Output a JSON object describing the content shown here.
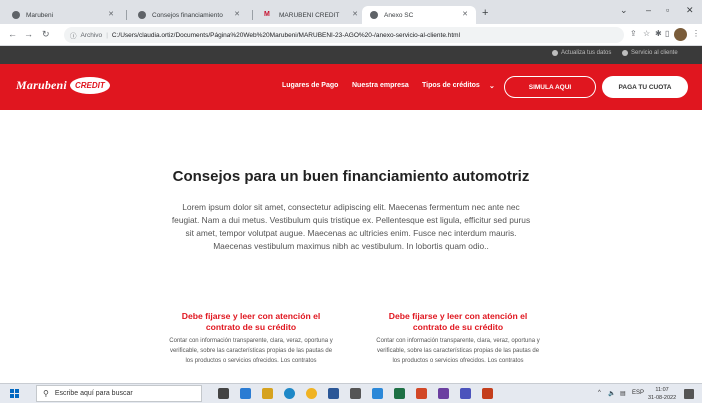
{
  "browser": {
    "tabs": [
      {
        "title": "Marubeni",
        "favicon": "globe-icon"
      },
      {
        "title": "Consejos financiamiento",
        "favicon": "globe-icon"
      },
      {
        "title": "MARUBENI CREDIT",
        "favicon": "m-logo-icon"
      },
      {
        "title": "Anexo SC",
        "favicon": "globe-icon",
        "active": true
      }
    ],
    "address": {
      "scheme_label": "Archivo",
      "url": "C:/Users/claudia.ortiz/Documents/Página%20Web%20Marubeni/MARUBENI-23-AGO%20-/anexo-servicio-al-cliente.html"
    }
  },
  "site": {
    "topbar": {
      "update_data": "Actualiza tus datos",
      "customer_service": "Servicio al cliente"
    },
    "logo": {
      "brand": "Marubeni",
      "credit": "CREDIT"
    },
    "menu": {
      "payment_places": "Lugares de Pago",
      "our_company": "Nuestra empresa",
      "credit_types": "Tipos de créditos"
    },
    "buttons": {
      "simulate": "SIMULA AQUI",
      "pay": "PAGA TU CUOTA"
    },
    "title": "Consejos para un buen financiamiento automotriz",
    "intro": "Lorem ipsum dolor sit amet, consectetur adipiscing elit. Maecenas fermentum nec ante nec feugiat. Nam a dui metus. Vestibulum quis tristique ex. Pellentesque est ligula, efficitur sed purus sit amet, tempor volutpat augue. Maecenas ac ultricies enim. Fusce nec interdum mauris. Maecenas vestibulum maximus nibh ac vestibulum. In lobortis quam odio..",
    "cards": [
      {
        "title": "Debe fijarse y leer con atención el contrato de su crédito",
        "text": "Contar con información transparente, clara, veraz, oportuna y verificable, sobre las características propias de las pautas de los productos o servicios ofrecidos. Los contratos"
      },
      {
        "title": "Debe fijarse y leer con atención el contrato de su crédito",
        "text": "Contar con información transparente, clara, veraz, oportuna y verificable, sobre las características propias de las pautas de los productos o servicios ofrecidos. Los contratos"
      }
    ]
  },
  "taskbar": {
    "search_placeholder": "Escribe aquí para buscar",
    "language": "ESP",
    "time": "11:07",
    "date": "31-08-2022"
  },
  "colors": {
    "brand_red": "#e0161f",
    "topbar": "#3a3a3a"
  }
}
